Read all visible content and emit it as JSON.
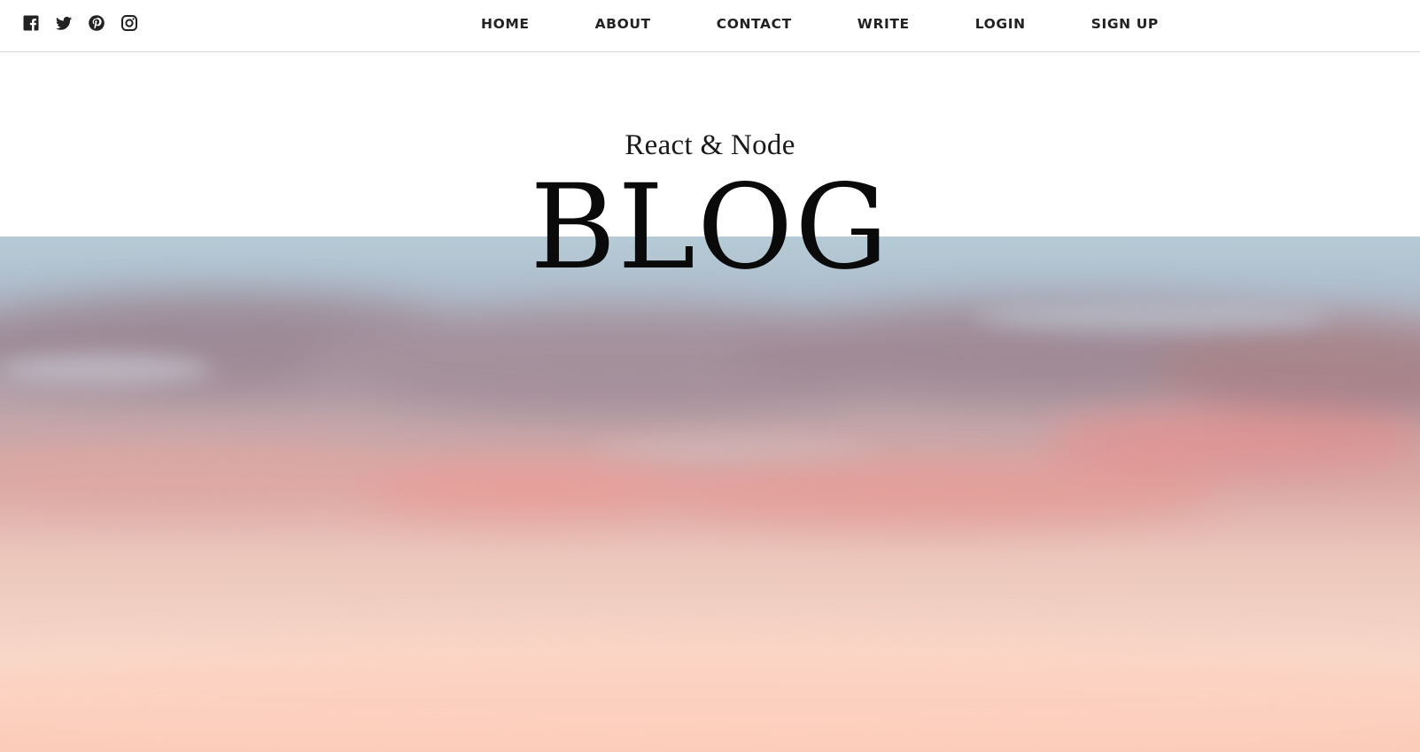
{
  "social": [
    {
      "name": "facebook-icon"
    },
    {
      "name": "twitter-icon"
    },
    {
      "name": "pinterest-icon"
    },
    {
      "name": "instagram-icon"
    }
  ],
  "nav": {
    "items": [
      "HOME",
      "ABOUT",
      "CONTACT",
      "WRITE",
      "LOGIN",
      "SIGN UP"
    ]
  },
  "header": {
    "subtitle": "React & Node",
    "title": "BLOG"
  },
  "colors": {
    "sky_top": "#b4cbd6",
    "cloud_mauve": "#9c8894",
    "cloud_pink": "#e39a98",
    "horizon_peach": "#f8d6c8"
  }
}
